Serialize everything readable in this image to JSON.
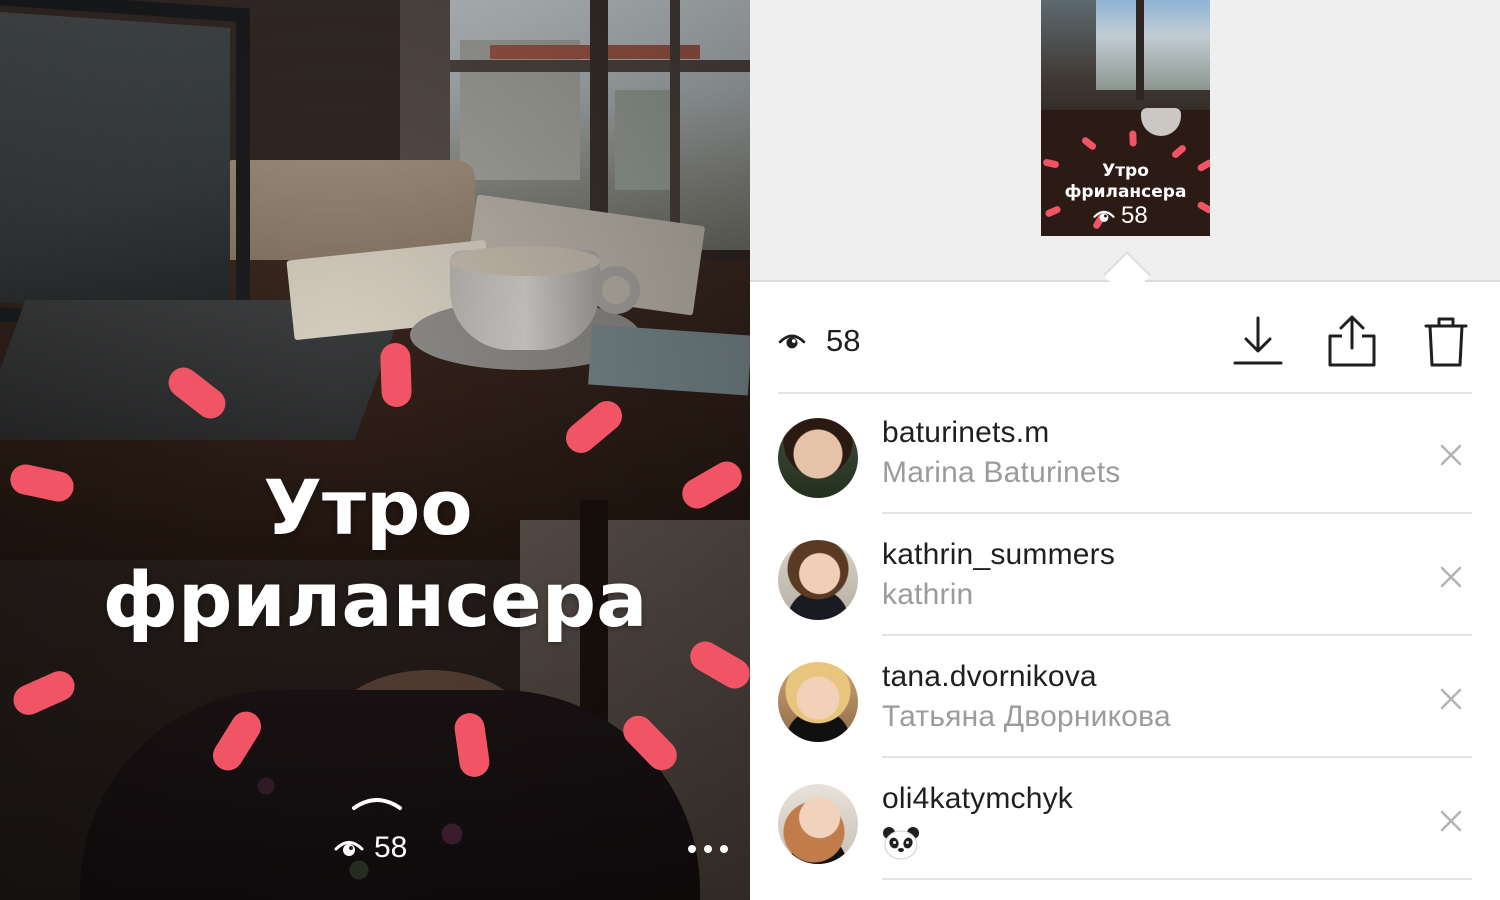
{
  "story": {
    "title_line1": "Утро",
    "title_line2": "фрилансера",
    "views": "58"
  },
  "thumbnail": {
    "title_line1": "Утро",
    "title_line2": "фрилансера",
    "views": "58"
  },
  "stats": {
    "views": "58"
  },
  "actions": [
    {
      "name": "download-icon"
    },
    {
      "name": "share-icon"
    },
    {
      "name": "trash-icon"
    }
  ],
  "viewers": [
    {
      "username": "baturinets.m",
      "full_name": "Marina Baturinets"
    },
    {
      "username": "kathrin_summers",
      "full_name": "kathrin"
    },
    {
      "username": "tana.dvornikova",
      "full_name": "Татьяна Дворникова"
    },
    {
      "username": "oli4katymchyk",
      "full_name": "",
      "emoji_icon": "panda-icon"
    }
  ],
  "colors": {
    "accent_dash": "#f15565",
    "text_primary": "#1f1f1f",
    "text_secondary": "#9b9b9b",
    "thumb_area_bg": "#efefef"
  }
}
